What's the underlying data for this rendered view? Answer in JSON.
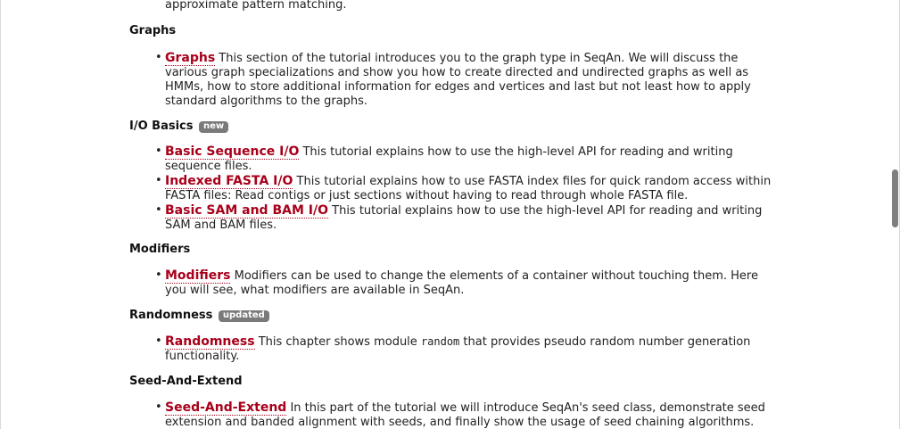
{
  "intro_text": "approximate pattern matching.",
  "sections": {
    "graphs": {
      "heading": "Graphs",
      "items": [
        {
          "link": "Graphs",
          "text": " This section of the tutorial introduces you to the graph type in SeqAn. We will discuss the various graph specializations and show you how to create directed and undirected graphs as well as HMMs, how to store additional information for edges and vertices and last but not least how to apply standard algorithms to the graphs."
        }
      ]
    },
    "io_basics": {
      "heading": "I/O Basics",
      "badge": "new",
      "items": [
        {
          "link": "Basic Sequence I/O",
          "text": " This tutorial explains how to use the high-level API for reading and writing sequence files."
        },
        {
          "link": "Indexed FASTA I/O",
          "text": " This tutorial explains how to use FASTA index files for quick random access within FASTA files: Read contigs or just sections without having to read through whole FASTA file."
        },
        {
          "link": "Basic SAM and BAM I/O",
          "text": " This tutorial explains how to use the high-level API for reading and writing SAM and BAM files."
        }
      ]
    },
    "modifiers": {
      "heading": "Modifiers",
      "items": [
        {
          "link": "Modifiers",
          "text": " Modifiers can be used to change the elements of a container without touching them. Here you will see, what modifiers are available in SeqAn."
        }
      ]
    },
    "randomness": {
      "heading": "Randomness",
      "badge": "updated",
      "items": [
        {
          "link": "Randomness",
          "text_before": " This chapter shows module ",
          "code": "random",
          "text_after": " that provides pseudo random number generation functionality."
        }
      ]
    },
    "seed_and_extend": {
      "heading": "Seed-And-Extend",
      "items": [
        {
          "link": "Seed-And-Extend",
          "text": " In this part of the tutorial we will introduce SeqAn's seed class, demonstrate seed extension and banded alignment with seeds, and finally show the usage of seed chaining algorithms."
        }
      ]
    }
  },
  "colors": {
    "link": "#a8001a",
    "badge": "#7a7a7a",
    "text": "#222222"
  }
}
